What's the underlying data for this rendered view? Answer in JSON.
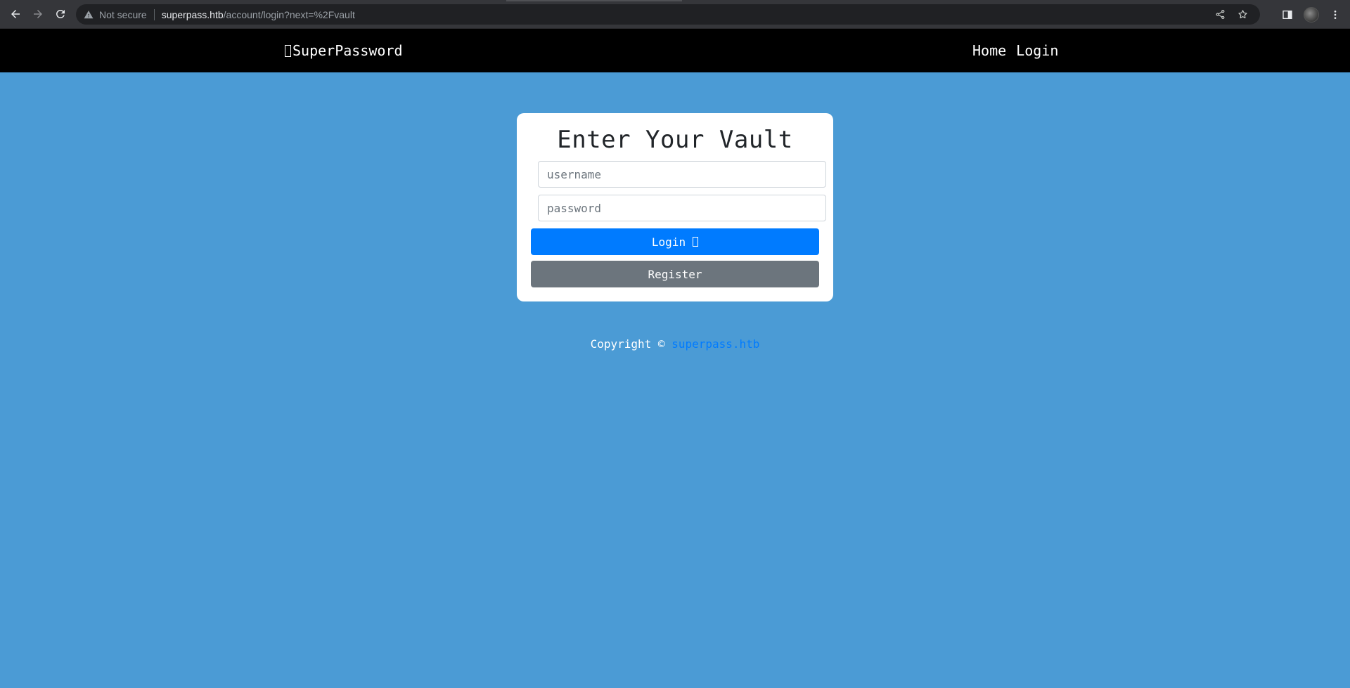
{
  "browser": {
    "back_icon": "arrow-left-icon",
    "forward_icon": "arrow-right-icon",
    "reload_icon": "reload-icon",
    "security_label": "Not secure",
    "url_host": "superpass.htb",
    "url_path": "/account/login?next=%2Fvault",
    "share_icon": "share-icon",
    "bookmark_icon": "star-icon",
    "sidepanel_icon": "side-panel-icon",
    "menu_icon": "kebab-menu-icon"
  },
  "navbar": {
    "brand": "SuperPassword",
    "links": [
      "Home",
      "Login"
    ]
  },
  "login_card": {
    "title": "Enter Your Vault",
    "username_placeholder": "username",
    "password_placeholder": "password",
    "login_label": "Login",
    "register_label": "Register"
  },
  "footer": {
    "copyright": "Copyright ©",
    "link_text": "superpass.htb"
  },
  "colors": {
    "page_background": "#4b9bd5",
    "navbar_background": "#000000",
    "primary": "#007bff",
    "secondary": "#6c757d"
  }
}
